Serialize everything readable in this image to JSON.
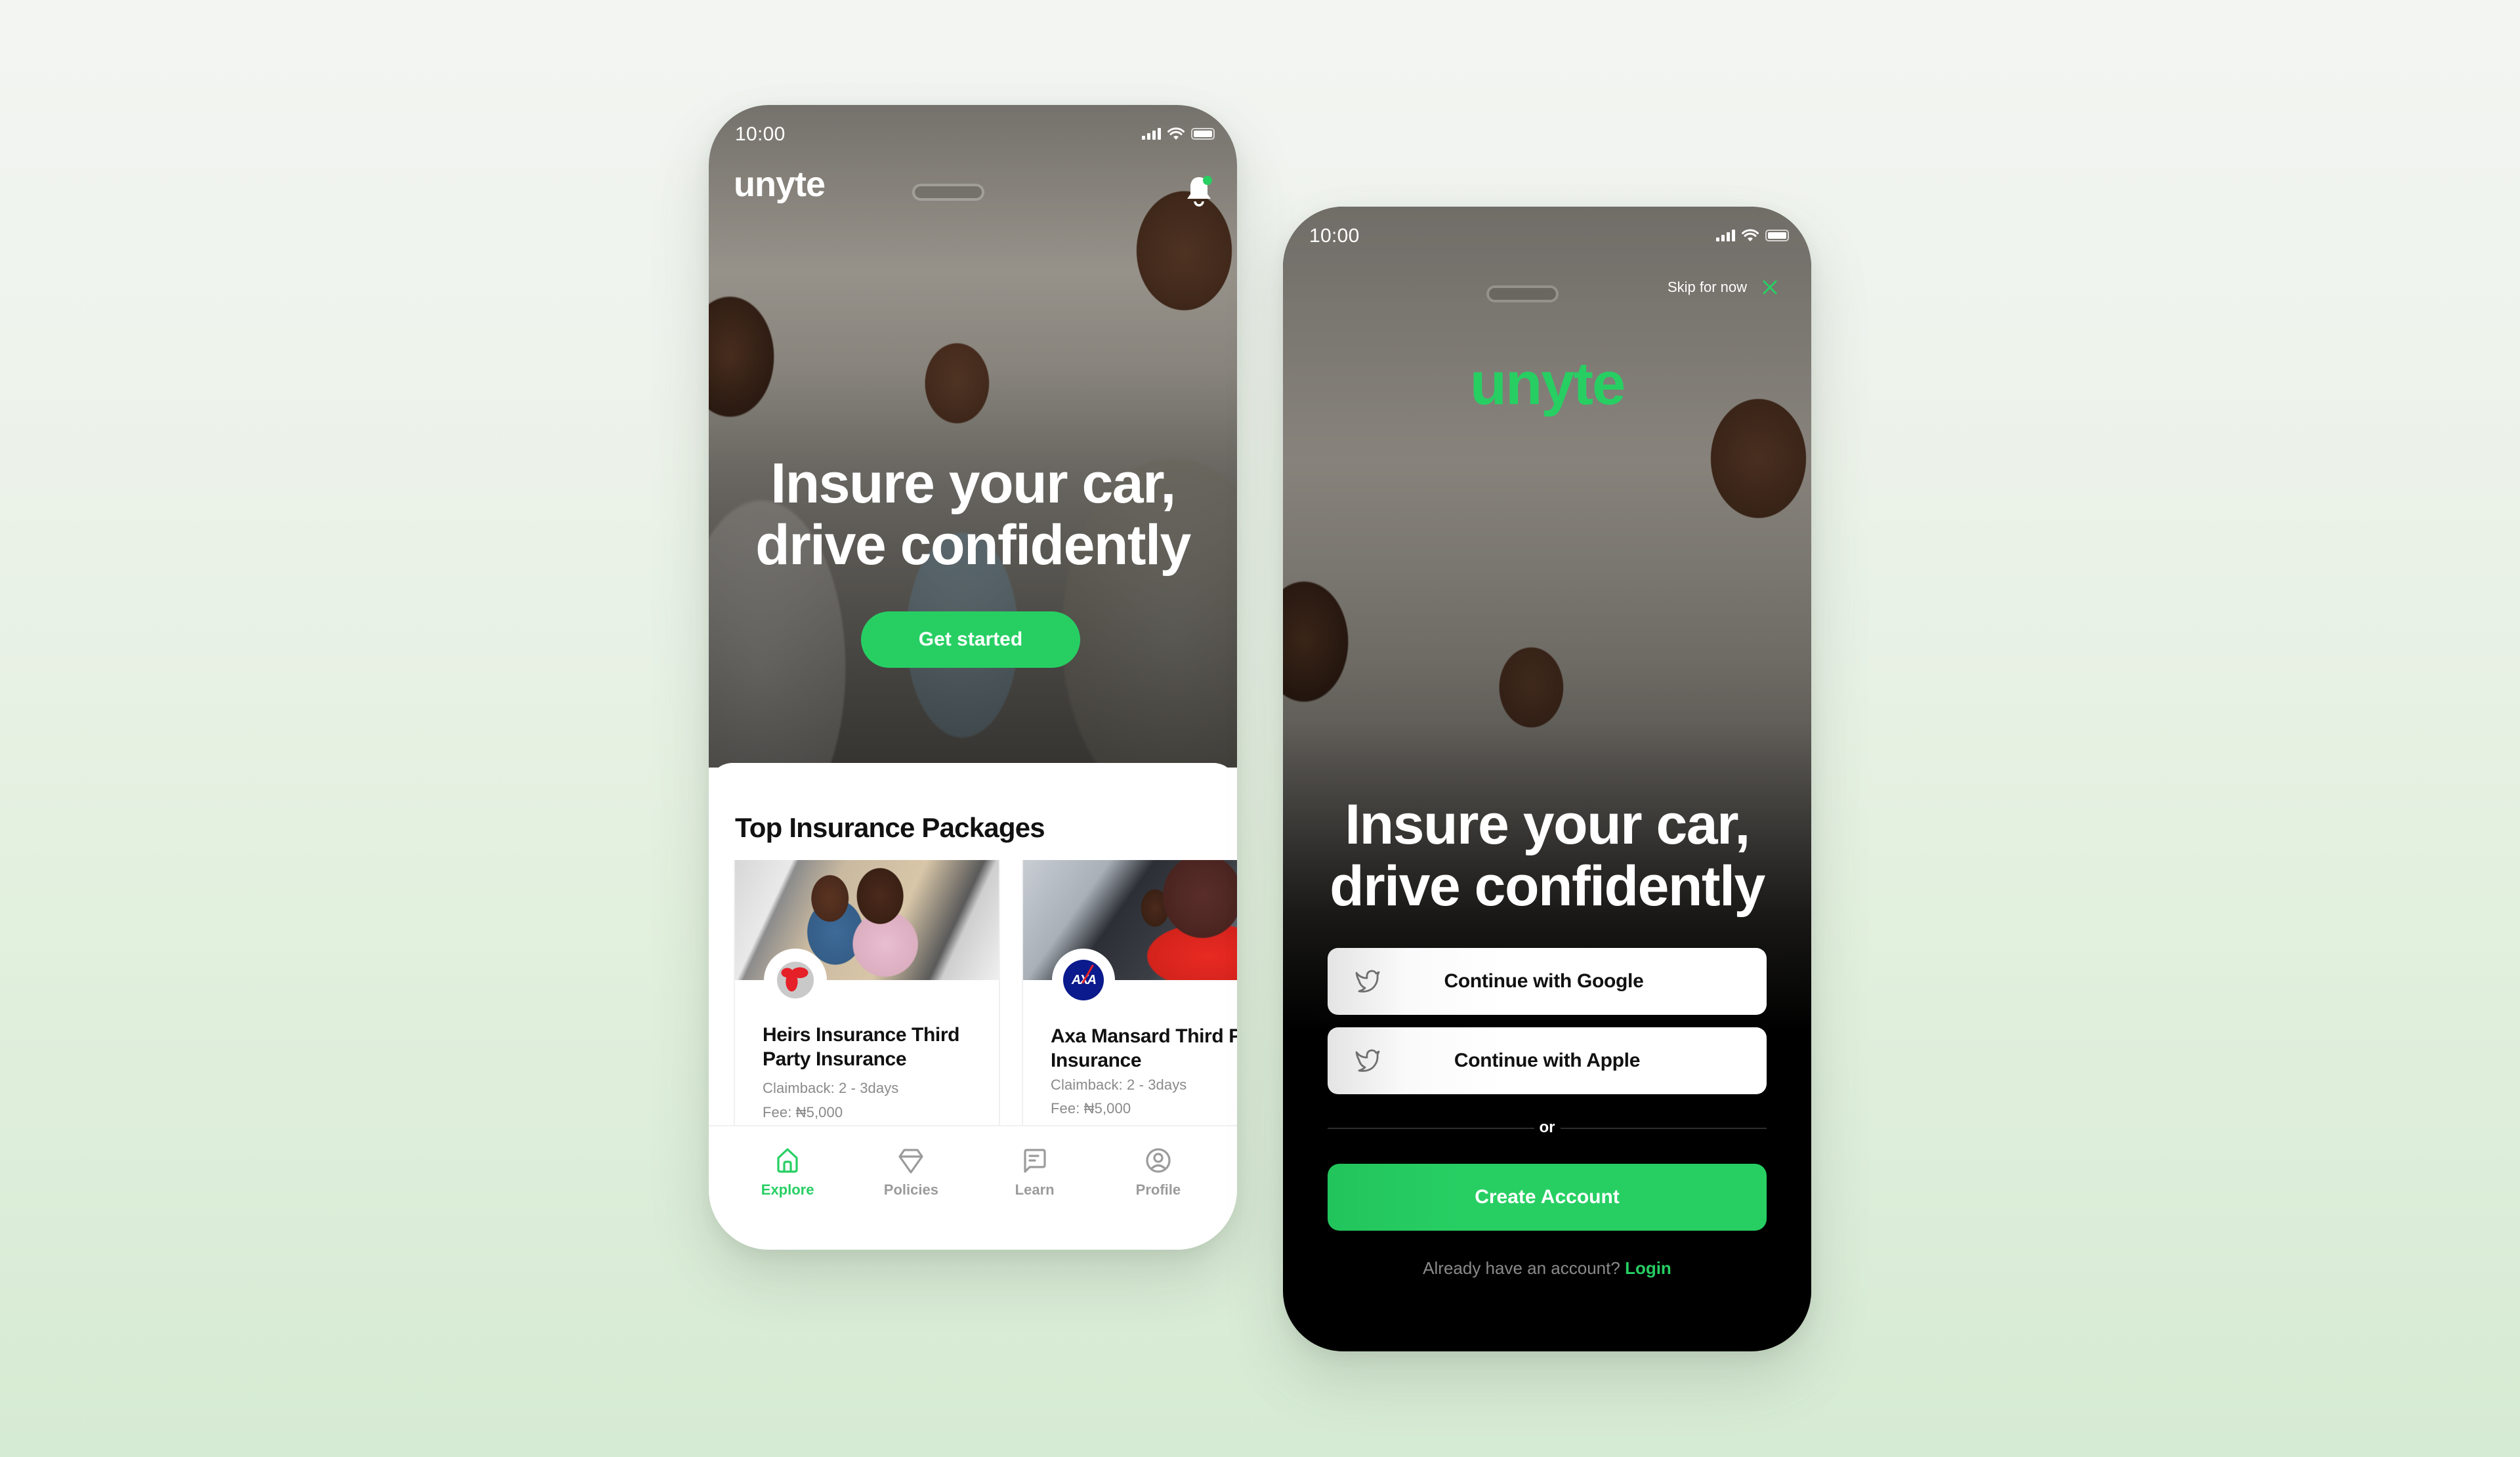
{
  "colors": {
    "brand_green": "#27cf63",
    "text_dark": "#111111",
    "text_muted": "#8a8a8a",
    "nav_inactive": "#9b9b9b",
    "axa_blue": "#0b1a8c",
    "heirs_red": "#e52028"
  },
  "explore_screen": {
    "status_bar": {
      "time": "10:00",
      "icons": [
        "signal-icon",
        "wifi-icon",
        "battery-icon"
      ]
    },
    "header": {
      "logo": "unyte",
      "notification_icon": "bell-icon",
      "has_unread": true
    },
    "hero": {
      "title_line1": "Insure your car,",
      "title_line2": "drive confidently",
      "cta_label": "Get started"
    },
    "section_title": "Top Insurance Packages",
    "packages": [
      {
        "title": "Heirs Insurance Third Party Insurance",
        "claimback": "Claimback: 2 - 3days",
        "fee": "Fee: ₦5,000",
        "logo": "heirs-globe-logo"
      },
      {
        "title": "Axa Mansard Third Party Insurance",
        "claimback": "Claimback: 2 - 3days",
        "fee": "Fee: ₦5,000",
        "logo": "axa-logo",
        "logo_text": "AXA"
      }
    ],
    "bottom_nav": [
      {
        "label": "Explore",
        "icon": "home-icon",
        "active": true
      },
      {
        "label": "Policies",
        "icon": "diamond-icon",
        "active": false
      },
      {
        "label": "Learn",
        "icon": "message-square-icon",
        "active": false
      },
      {
        "label": "Profile",
        "icon": "user-circle-icon",
        "active": false
      }
    ]
  },
  "signup_screen": {
    "status_bar": {
      "time": "10:00",
      "icons": [
        "signal-icon",
        "wifi-icon",
        "battery-icon"
      ]
    },
    "skip_label": "Skip for now",
    "logo": "unyte",
    "hero": {
      "title_line1": "Insure your car,",
      "title_line2": "drive confidently"
    },
    "google_button": "Continue with Google",
    "apple_button": "Continue with Apple",
    "divider_text": "or",
    "create_account_button": "Create Account",
    "login_prompt": "Already have an account?",
    "login_link": "Login"
  }
}
